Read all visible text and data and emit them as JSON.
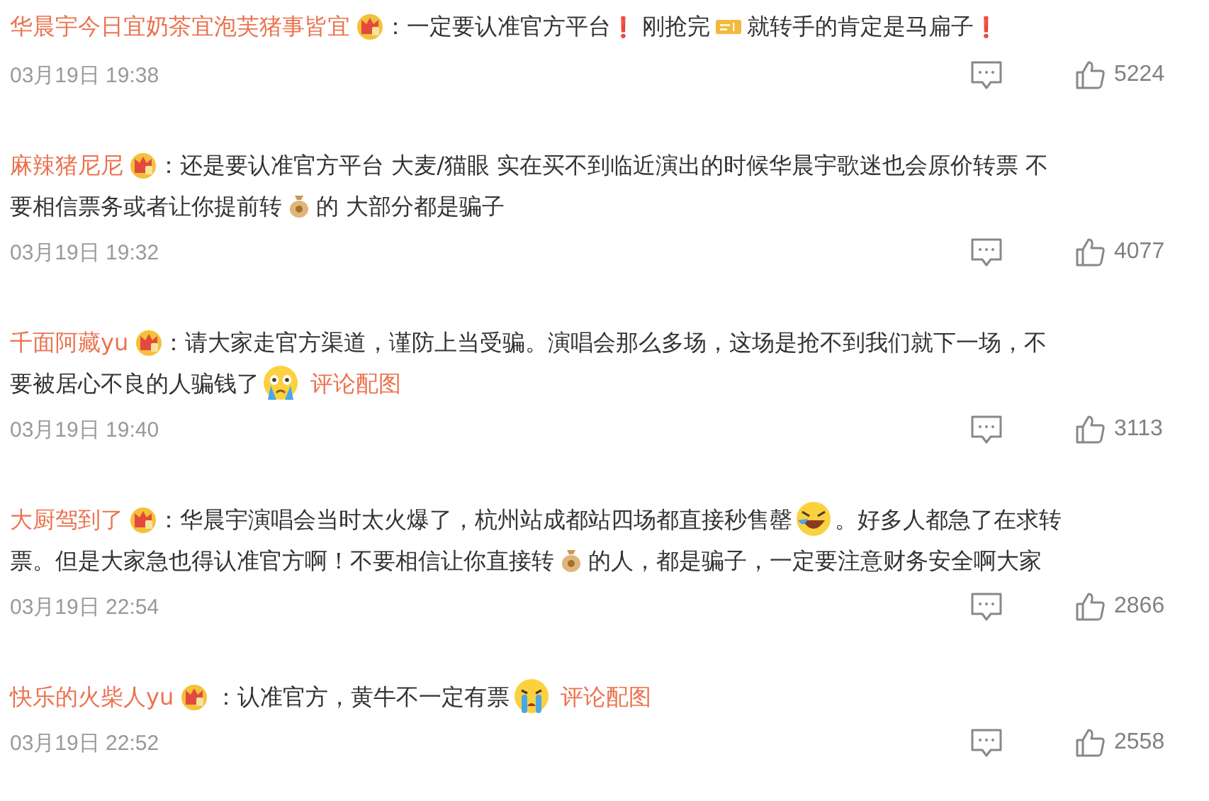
{
  "comments": [
    {
      "user": "华晨宇今日宜奶茶宜泡芙猪事皆宜",
      "separator": "：",
      "segments": [
        {
          "kind": "text",
          "text": "一定要认准官方平台"
        },
        {
          "kind": "mark",
          "text": "❗"
        },
        {
          "kind": "text",
          "text": " 刚抢完"
        },
        {
          "kind": "ticket"
        },
        {
          "kind": "text",
          "text": "就转手的肯定是马扁子"
        },
        {
          "kind": "mark",
          "text": "❗"
        }
      ],
      "date": "03月19日 19:38",
      "likes": "5224"
    },
    {
      "user": "麻辣猪尼尼",
      "separator": "：",
      "segments": [
        {
          "kind": "text",
          "text": "还是要认准官方平台 大麦/猫眼 实在买不到临近演出的时候华晨宇歌迷也会原价转票 不"
        },
        {
          "kind": "break"
        },
        {
          "kind": "text",
          "text": "要相信票务或者让你提前转"
        },
        {
          "kind": "moneybag"
        },
        {
          "kind": "text",
          "text": "的 大部分都是骗子"
        }
      ],
      "date": "03月19日 19:32",
      "likes": "4077"
    },
    {
      "user": "千面阿藏yu",
      "separator": "：",
      "segments": [
        {
          "kind": "text",
          "text": "请大家走官方渠道，谨防上当受骗。演唱会那么多场，这场是抢不到我们就下一场，不"
        },
        {
          "kind": "break"
        },
        {
          "kind": "text",
          "text": "要被居心不良的人骗钱了"
        },
        {
          "kind": "crying"
        },
        {
          "kind": "link",
          "text": "评论配图"
        }
      ],
      "date": "03月19日 19:40",
      "likes": "3113"
    },
    {
      "user": "大厨驾到了",
      "separator": "：",
      "segments": [
        {
          "kind": "text",
          "text": "华晨宇演唱会当时太火爆了，杭州站成都站四场都直接秒售罄"
        },
        {
          "kind": "laughing"
        },
        {
          "kind": "text",
          "text": "。好多人都急了在求转"
        },
        {
          "kind": "break"
        },
        {
          "kind": "text",
          "text": "票。但是大家急也得认准官方啊！不要相信让你直接转"
        },
        {
          "kind": "moneybag"
        },
        {
          "kind": "text",
          "text": "的人，都是骗子，一定要注意财务安全啊大家"
        }
      ],
      "date": "03月19日 22:54",
      "likes": "2866"
    },
    {
      "user": "快乐的火柴人yu",
      "separator": " ：",
      "segments": [
        {
          "kind": "text",
          "text": "认准官方，黄牛不一定有票"
        },
        {
          "kind": "sobbing"
        },
        {
          "kind": "link",
          "text": "评论配图"
        }
      ],
      "date": "03月19日 22:52",
      "likes": "2558"
    }
  ]
}
